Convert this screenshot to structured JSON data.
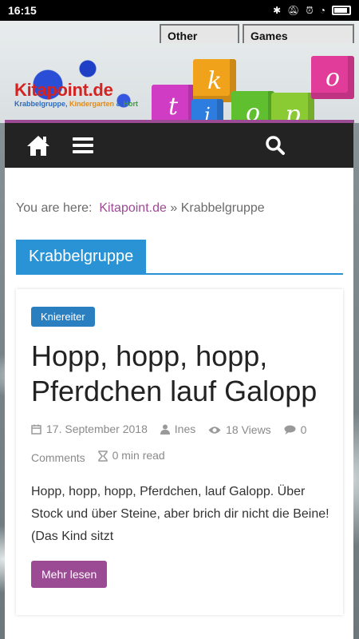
{
  "status": {
    "time": "16:15"
  },
  "header": {
    "tabs": [
      "Other",
      "Games"
    ],
    "logo_title": "Kitapoint.de",
    "logo_sub_1": "Krabbelgruppe, ",
    "logo_sub_2": "Kindergarten",
    "logo_sub_3": " & ",
    "logo_sub_4": "Hort",
    "cube_letters": [
      "t",
      "k",
      "o",
      "i",
      "p",
      "o"
    ]
  },
  "breadcrumb": {
    "prefix": "You are here:",
    "home": "Kitapoint.de",
    "separator": "»",
    "current": "Krabbelgruppe"
  },
  "section": {
    "title": "Krabbelgruppe"
  },
  "post": {
    "category": "Kniereiter",
    "title": "Hopp, hopp, hopp, Pferdchen lauf Galopp",
    "date": "17. September 2018",
    "author": "Ines",
    "views": "18 Views",
    "comments_count": "0",
    "comments_label": "Comments",
    "read_time": "0 min read",
    "excerpt": "Hopp, hopp, hopp, Pferdchen, lauf Galopp. Über Stock und über Steine, aber brich dir nicht die Beine! (Das Kind sitzt",
    "more": "Mehr lesen"
  }
}
